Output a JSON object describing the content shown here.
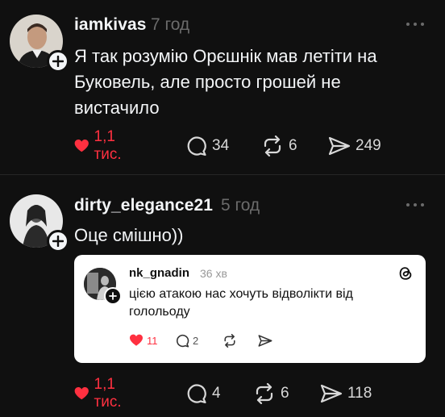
{
  "posts": [
    {
      "username": "iamkivas",
      "time": "7 год",
      "text": [
        "Я так розумію Орєшнік мав летіти на",
        "Буковель, але просто грошей не",
        "вистачило"
      ],
      "likes": "1,1 тис.",
      "comments": "34",
      "reposts": "6",
      "shares": "249",
      "liked": true
    },
    {
      "username": "dirty_elegance21",
      "time": "5 год",
      "text": [
        "Оце смішно))"
      ],
      "likes": "1,1 тис.",
      "comments": "4",
      "reposts": "6",
      "shares": "118",
      "liked": true,
      "quote": {
        "username": "nk_gnadin",
        "time": "36 хв",
        "text": [
          "цією атакою нас хочуть відволікти від",
          "голольоду"
        ],
        "likes": "11",
        "comments": "2"
      }
    }
  ],
  "colors": {
    "background": "#101010",
    "like_red": "#ff3040",
    "muted": "#6b6b6b"
  },
  "icons": [
    "heart-icon",
    "comment-icon",
    "repost-icon",
    "share-icon",
    "more-icon",
    "plus-icon",
    "threads-logo-icon"
  ]
}
